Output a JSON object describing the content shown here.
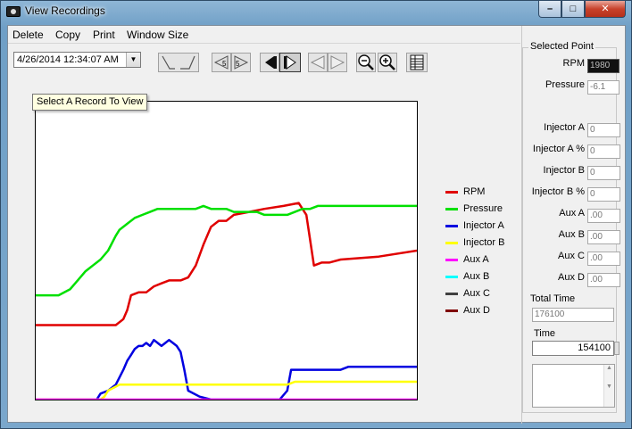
{
  "window": {
    "title": "View Recordings",
    "minimize_glyph": "–",
    "maximize_glyph": "□",
    "close_glyph": "✕"
  },
  "menu": {
    "delete": "Delete",
    "copy": "Copy",
    "print": "Print",
    "window_size": "Window Size"
  },
  "toolbar": {
    "record_select_value": "4/26/2014 12:34:07 AM",
    "tooltip": "Select A Record To View",
    "icons": [
      "line-style-icon",
      "step-back-5-icon",
      "step-forward-5-icon",
      "first-record-icon",
      "last-record-icon",
      "previous-icon",
      "next-icon",
      "zoom-out-icon",
      "zoom-in-icon",
      "data-table-icon"
    ]
  },
  "legend": [
    {
      "name": "RPM",
      "color": "#e00000"
    },
    {
      "name": "Pressure",
      "color": "#00e000"
    },
    {
      "name": "Injector A",
      "color": "#0000e0"
    },
    {
      "name": "Injector B",
      "color": "#ffff00"
    },
    {
      "name": "Aux A",
      "color": "#ff00ff"
    },
    {
      "name": "Aux B",
      "color": "#00ffff"
    },
    {
      "name": "Aux C",
      "color": "#404040"
    },
    {
      "name": "Aux D",
      "color": "#800000"
    }
  ],
  "selected_point": {
    "title": "Selected Point",
    "rpm_label": "RPM",
    "rpm_value": "1980",
    "pressure_label": "Pressure",
    "pressure_value": "-6.1",
    "injector_a_label": "Injector A",
    "injector_a_value": "0",
    "injector_a_pct_label": "Injector A %",
    "injector_a_pct_value": "0",
    "injector_b_label": "Injector B",
    "injector_b_value": "0",
    "injector_b_pct_label": "Injector B %",
    "injector_b_pct_value": "0",
    "aux_a_label": "Aux A",
    "aux_a_value": ".00",
    "aux_b_label": "Aux B",
    "aux_b_value": ".00",
    "aux_c_label": "Aux C",
    "aux_c_value": ".00",
    "aux_d_label": "Aux D",
    "aux_d_value": ".00",
    "total_time_label": "Total Time",
    "total_time_value": "176100",
    "time_label": "Time",
    "time_value": "154100"
  },
  "chart_data": {
    "type": "line",
    "title": "",
    "xlabel": "",
    "ylabel": "",
    "x_range": [
      0,
      100
    ],
    "y_range": [
      0,
      100
    ],
    "grid": false,
    "legend_position": "right",
    "series": [
      {
        "name": "RPM",
        "color": "#e00000",
        "x": [
          0,
          9,
          18,
          21,
          23,
          24,
          25,
          27,
          29,
          31,
          33,
          35,
          38,
          40,
          42,
          44,
          46,
          48,
          50,
          52,
          56,
          60,
          65,
          69,
          71,
          73,
          75,
          77,
          80,
          90,
          100
        ],
        "y": [
          25,
          25,
          25,
          25,
          27,
          30,
          35,
          36,
          36,
          38,
          39,
          40,
          40,
          41,
          45,
          52,
          58,
          60,
          60,
          62,
          63,
          64,
          65,
          66,
          62,
          45,
          46,
          46,
          47,
          48,
          50
        ]
      },
      {
        "name": "Pressure",
        "color": "#00e000",
        "x": [
          0,
          6,
          9,
          11,
          13,
          14,
          15,
          17,
          19,
          21,
          22,
          23,
          24,
          26,
          28,
          30,
          32,
          34,
          36,
          39,
          42,
          44,
          46,
          48,
          50,
          52,
          55,
          58,
          60,
          62,
          64,
          66,
          68,
          70,
          72,
          74,
          78,
          84,
          90,
          96,
          100
        ],
        "y": [
          35,
          35,
          37,
          40,
          43,
          44,
          45,
          47,
          50,
          55,
          57,
          58,
          59,
          61,
          62,
          63,
          64,
          64,
          64,
          64,
          64,
          65,
          64,
          64,
          64,
          63,
          63,
          63,
          62,
          62,
          62,
          62,
          63,
          64,
          64,
          65,
          65,
          65,
          65,
          65,
          65
        ]
      },
      {
        "name": "Injector A",
        "color": "#0000e0",
        "x": [
          0,
          14,
          16,
          17,
          19,
          21,
          23,
          24,
          25,
          26,
          27,
          28,
          29,
          30,
          31,
          32,
          33,
          34,
          35,
          36,
          37,
          38,
          39,
          40,
          43,
          46,
          48,
          50,
          52,
          54,
          56,
          58,
          60,
          62,
          64,
          66,
          67,
          68,
          70,
          72,
          74,
          76,
          78,
          80,
          82,
          84,
          86,
          88,
          90,
          92,
          94,
          96,
          98,
          100
        ],
        "y": [
          0,
          0,
          0,
          2,
          3,
          5,
          10,
          13,
          15,
          17,
          18,
          18,
          19,
          18,
          20,
          19,
          18,
          19,
          20,
          19,
          18,
          16,
          10,
          3,
          1,
          0,
          0,
          0,
          0,
          0,
          0,
          0,
          0,
          0,
          0,
          3,
          10,
          10,
          10,
          10,
          10,
          10,
          10,
          10,
          11,
          11,
          11,
          11,
          11,
          11,
          11,
          11,
          11,
          11
        ]
      },
      {
        "name": "Injector B",
        "color": "#ffff00",
        "x": [
          0,
          16,
          17,
          18,
          19,
          22,
          27,
          32,
          37,
          40,
          45,
          50,
          55,
          60,
          64,
          66,
          68,
          72,
          80,
          90,
          100
        ],
        "y": [
          0,
          0,
          0,
          1,
          3,
          5,
          5,
          5,
          5,
          5,
          5,
          5,
          5,
          5,
          5,
          5,
          6,
          6,
          6,
          6,
          6
        ]
      },
      {
        "name": "Aux A",
        "color": "#ff00ff",
        "x": [
          0,
          100
        ],
        "y": [
          0,
          0
        ]
      }
    ]
  }
}
